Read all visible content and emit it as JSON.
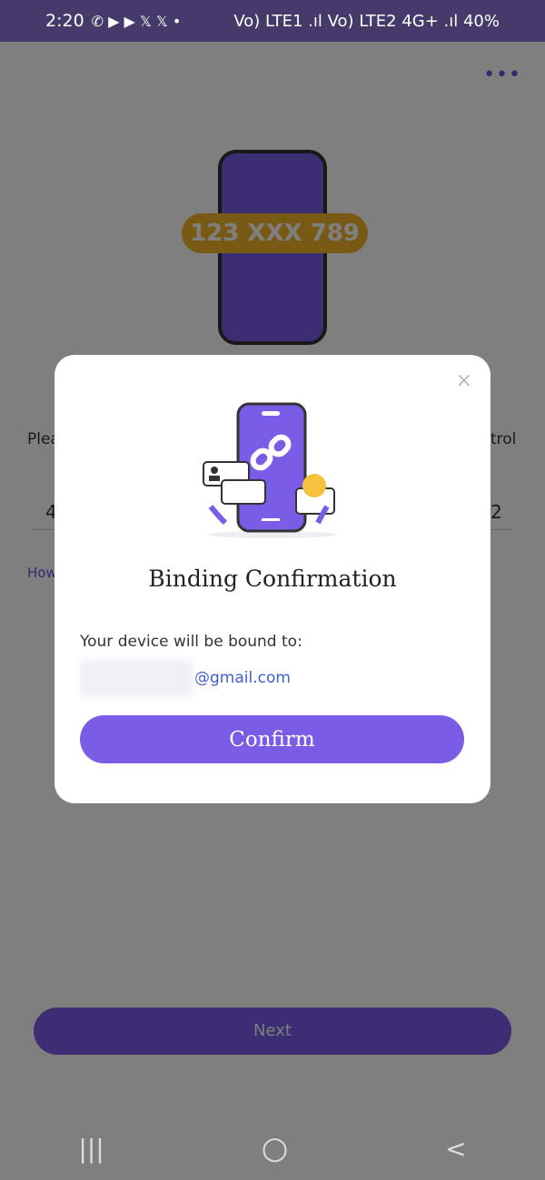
{
  "status_bar": {
    "time": "2:20",
    "right": "Vo) LTE1 .ıl Vo) LTE2 4G+ .ıl 40%",
    "notif_icons": "✆ ▶ ▶ 𝕏 𝕏 •"
  },
  "background": {
    "more_label": "•••",
    "code_badge": "123 XXX 789",
    "prompt_start": "Plea",
    "prompt_end": "trol",
    "input_start": "4",
    "input_end": "2",
    "help_link": "How",
    "next_label": "Next"
  },
  "modal": {
    "title": "Binding Confirmation",
    "label": "Your device will be bound to:",
    "email_domain": "@gmail.com",
    "confirm_label": "Confirm",
    "close_label": "×"
  },
  "nav": {
    "recents": "|||",
    "home": "○",
    "back": "<"
  },
  "colors": {
    "accent": "#7b5ce6",
    "status_bar": "#463a6a",
    "link": "#3d5fd0"
  }
}
